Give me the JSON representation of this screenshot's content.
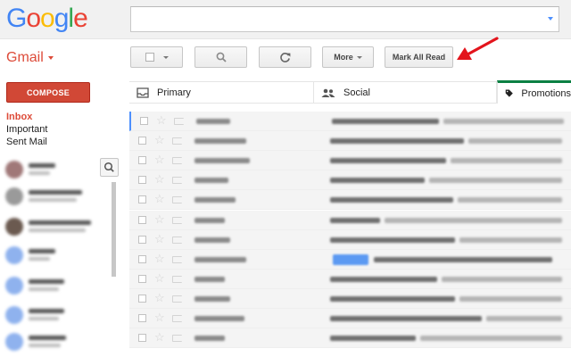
{
  "header": {
    "logo_letters": [
      {
        "ch": "G",
        "color": "#4285f4"
      },
      {
        "ch": "o",
        "color": "#ea4335"
      },
      {
        "ch": "o",
        "color": "#fbbc05"
      },
      {
        "ch": "g",
        "color": "#4285f4"
      },
      {
        "ch": "l",
        "color": "#34a853"
      },
      {
        "ch": "e",
        "color": "#ea4335"
      }
    ],
    "search_value": ""
  },
  "toolbar": {
    "app_label": "Gmail",
    "more_label": "More",
    "mark_all_read_label": "Mark All Read"
  },
  "nav": {
    "compose_label": "COMPOSE",
    "items": [
      "Inbox",
      "Important",
      "Sent Mail"
    ]
  },
  "tabs": {
    "primary": "Primary",
    "social": "Social",
    "promotions": "Promotions"
  },
  "colors": {
    "compose_bg": "#d14836",
    "active_nav": "#dd4b39",
    "promo_tab_accent": "#0b8043",
    "arrow": "#e3141c"
  }
}
